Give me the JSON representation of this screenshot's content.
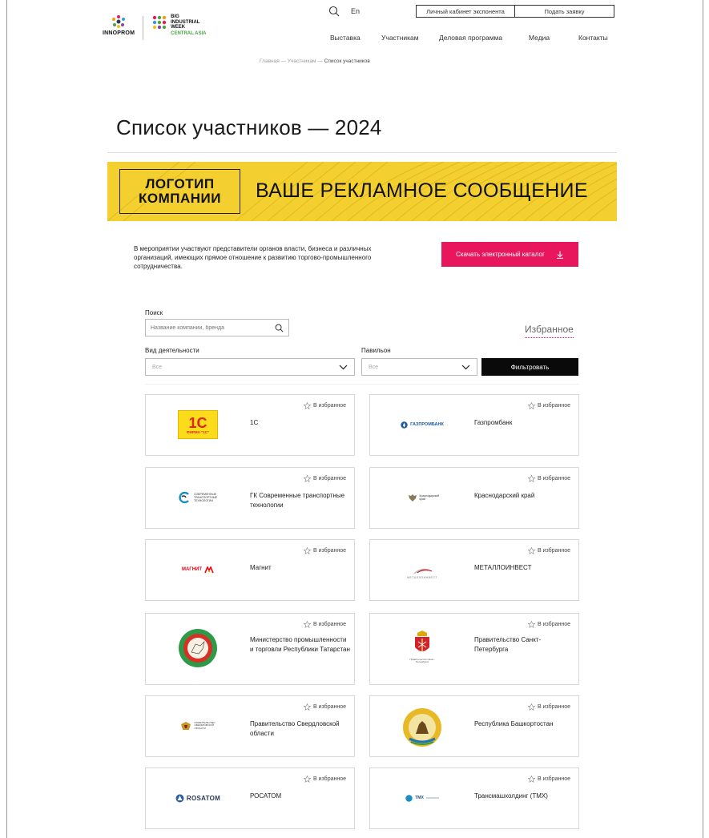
{
  "header": {
    "innoprom_label": "INNOPROM",
    "biw_line1": "BIG",
    "biw_line2": "INDUSTRIAL",
    "biw_line3": "WEEK",
    "biw_line4": "CENTRAL ASIA",
    "lang": "En",
    "cabinet_label": "Личный кабинет экспонента",
    "apply_label": "Подать заявку",
    "nav": [
      "Выставка",
      "Участникам",
      "Деловая программа",
      "Медиа",
      "Контакты"
    ]
  },
  "breadcrumbs": {
    "home": "Главная",
    "section": "Участникам",
    "current": "Список участников",
    "separator": "—"
  },
  "page_title": "Список участников — 2024",
  "banner": {
    "logo_line1": "ЛОГОТИП",
    "logo_line2": "КОМПАНИИ",
    "message": "ВАШЕ РЕКЛАМНОЕ СООБЩЕНИЕ"
  },
  "intro_text": "В мероприятии участвуют представители органов власти, бизнеса и различных организаций, имеющих прямое отношение к развитию торгово-промышленного сотрудничества.",
  "download_label": "Скачать электронный каталог",
  "filters": {
    "search_label": "Поиск",
    "search_placeholder": "Название компании, бренда",
    "favorites_label": "Избранное",
    "activity_label": "Вид деятельности",
    "activity_value": "Все",
    "pavilion_label": "Павильон",
    "pavilion_value": "Все",
    "filter_button": "Фильтровать"
  },
  "fav_label": "В избранное",
  "participants": [
    {
      "name": "1С",
      "logo": "1c-logo",
      "logo_text": "1С",
      "logo_sub": "ФИРМА \"1С\""
    },
    {
      "name": "Газпромбанк",
      "logo": "gazprombank-logo",
      "logo_text": "ГАЗПРОМБАНК"
    },
    {
      "name": "ГК Современные транспортные технологии",
      "logo": "stt-logo",
      "logo_text": "СОВРЕМЕННЫЕ ТРАНСПОРТНЫЕ ТЕХНОЛОГИИ"
    },
    {
      "name": "Краснодарский край",
      "logo": "krasnodar-logo",
      "logo_text": "Краснодарский край"
    },
    {
      "name": "Магнит",
      "logo": "magnit-logo",
      "logo_text": "МАГНИТ"
    },
    {
      "name": "МЕТАЛЛОИНВЕСТ",
      "logo": "metalloinvest-logo",
      "logo_text": "МЕТАЛЛОИНВЕСТ"
    },
    {
      "name": "Министерство промышленности и торговли Республики Татарстан",
      "logo": "tatarstan-logo"
    },
    {
      "name": "Правительство Санкт-Петербурга",
      "logo": "spb-logo",
      "logo_text": "Правительство Санкт-Петербурга"
    },
    {
      "name": "Правительство Свердловской области",
      "logo": "sverdlovsk-logo",
      "logo_text": "ПРАВИТЕЛЬСТВО СВЕРДЛОВСКОЙ ОБЛАСТИ"
    },
    {
      "name": "Республика Башкортостан",
      "logo": "bashkortostan-logo"
    },
    {
      "name": "РОСАТОМ",
      "logo": "rosatom-logo",
      "logo_text": "ROSATOM"
    },
    {
      "name": "Трансмашхолдинг (ТМХ)",
      "logo": "tmh-logo",
      "logo_text": "ТМХ"
    }
  ],
  "colors": {
    "accent_pink": "#e8175d",
    "banner_yellow": "#f3d02f",
    "filter_black": "#0a0a0a"
  }
}
